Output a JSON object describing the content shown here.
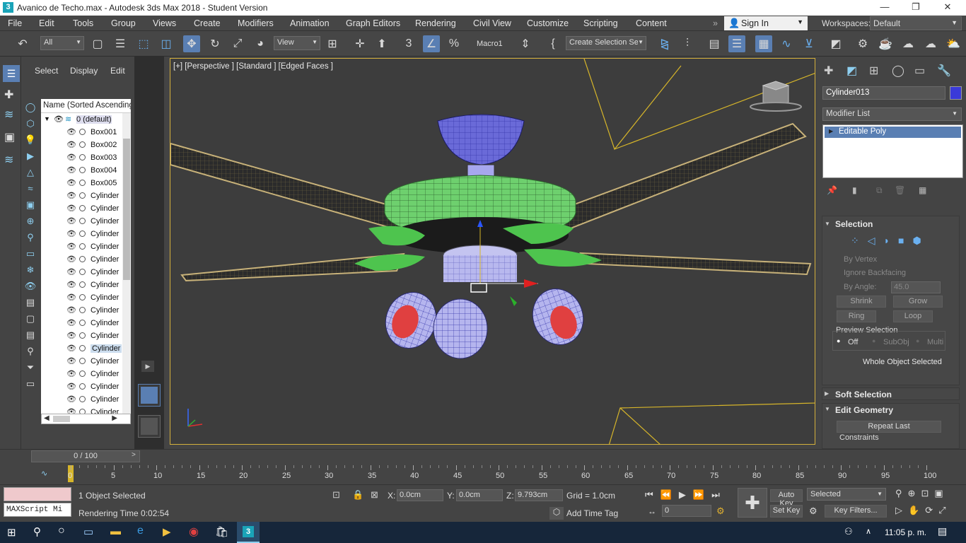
{
  "title": "Avanico de Techo.max - Autodesk 3ds Max 2018 - Student Version",
  "menu": [
    "File",
    "Edit",
    "Tools",
    "Group",
    "Views",
    "Create",
    "Modifiers",
    "Animation",
    "Graph Editors",
    "Rendering",
    "Civil View",
    "Customize",
    "Scripting",
    "Content"
  ],
  "signin": "Sign In",
  "workspaces_label": "Workspaces:",
  "workspace": "Default",
  "toolbar": {
    "filter": "All",
    "refcoord": "View",
    "macro": "Macro1",
    "selset": "Create Selection Se"
  },
  "explorer": {
    "tabs": [
      "Select",
      "Display",
      "Edit"
    ],
    "header": "Name (Sorted Ascending)",
    "layer": "0 (default)",
    "items": [
      "Box001",
      "Box002",
      "Box003",
      "Box004",
      "Box005",
      "Cylinder",
      "Cylinder",
      "Cylinder",
      "Cylinder",
      "Cylinder",
      "Cylinder",
      "Cylinder",
      "Cylinder",
      "Cylinder",
      "Cylinder",
      "Cylinder",
      "Cylinder",
      "Cylinder",
      "Cylinder",
      "Cylinder",
      "Cylinder",
      "Cylinder",
      "Cylinder"
    ]
  },
  "viewport_label": "[+] [Perspective ] [Standard ] [Edged Faces ]",
  "command_panel": {
    "object_name": "Cylinder013",
    "modifier_list": "Modifier List",
    "stack_item": "Editable Poly",
    "selection_header": "Selection",
    "by_vertex": "By Vertex",
    "ignore_backfacing": "Ignore Backfacing",
    "by_angle": "By Angle:",
    "angle_value": "45.0",
    "shrink": "Shrink",
    "grow": "Grow",
    "ring": "Ring",
    "loop": "Loop",
    "preview_selection": "Preview Selection",
    "off": "Off",
    "subobj": "SubObj",
    "multi": "Multi",
    "whole_object": "Whole Object Selected",
    "soft_selection": "Soft Selection",
    "edit_geometry": "Edit Geometry",
    "repeat_last": "Repeat Last",
    "constraints": "Constraints"
  },
  "timeslider": "0 / 100",
  "ruler_ticks": [
    "0",
    "5",
    "10",
    "15",
    "20",
    "25",
    "30",
    "35",
    "40",
    "45",
    "50",
    "55",
    "60",
    "65",
    "70",
    "75",
    "80",
    "85",
    "90",
    "95",
    "100"
  ],
  "status": {
    "maxscript": "MAXScript Mi",
    "objects_selected": "1 Object Selected",
    "rendering_time": "Rendering Time  0:02:54",
    "x_label": "X:",
    "x": "0.0cm",
    "y_label": "Y:",
    "y": "0.0cm",
    "z_label": "Z:",
    "z": "9.793cm",
    "grid": "Grid = 1.0cm",
    "add_time_tag": "Add Time Tag",
    "auto_key": "Auto Key",
    "selected": "Selected",
    "set_key": "Set Key",
    "key_filters": "Key Filters...",
    "frame": "0"
  },
  "taskbar_time": "11:05 p. m."
}
